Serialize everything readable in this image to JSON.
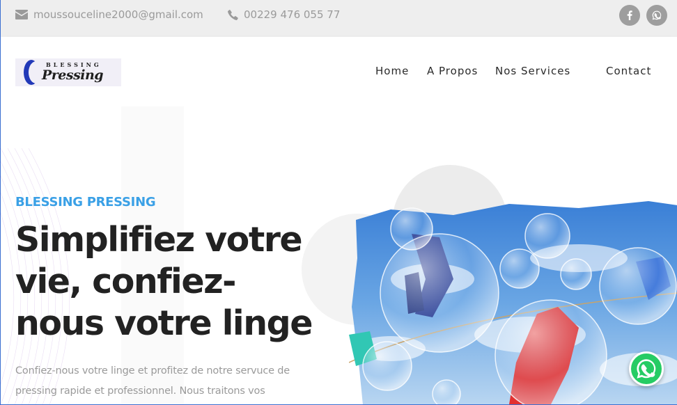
{
  "topbar": {
    "email": "moussouceline2000@gmail.com",
    "phone": "00229 476 055 77",
    "icons": [
      "envelope-icon",
      "phone-icon",
      "facebook-icon",
      "whatsapp-icon"
    ]
  },
  "brand": {
    "logo_top": "BLESSING",
    "logo_bottom": "Pressing"
  },
  "nav": {
    "items": [
      {
        "label": "Home"
      },
      {
        "label": "A Propos"
      },
      {
        "label": "Nos Services"
      },
      {
        "label": "Contact"
      }
    ]
  },
  "hero": {
    "eyebrow": "BLESSING PRESSING",
    "headline_lines": [
      "Simplifiez votre",
      "vie, confiez-",
      "nous votre linge"
    ],
    "paragraph": "Confiez-nous votre linge et profitez de notre servuce de pressing rapide et professionnel. Nous traitons vos"
  },
  "colors": {
    "accent": "#3aa0e6",
    "heading": "#222222",
    "topbar_bg": "#eeeeee",
    "whatsapp": "#26cc64"
  }
}
